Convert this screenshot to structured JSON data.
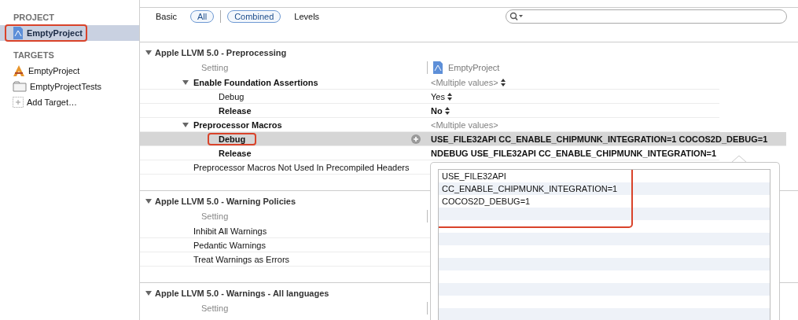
{
  "sidebar": {
    "sections": [
      {
        "title": "PROJECT",
        "items": [
          {
            "kind": "project",
            "label": "EmptyProject",
            "selected": true,
            "highlighted": true
          }
        ]
      },
      {
        "title": "TARGETS",
        "items": [
          {
            "kind": "app",
            "label": "EmptyProject",
            "selected": false,
            "highlighted": false
          },
          {
            "kind": "tests",
            "label": "EmptyProjectTests",
            "selected": false,
            "highlighted": false
          },
          {
            "kind": "add",
            "label": "Add Target…",
            "selected": false,
            "highlighted": false
          }
        ]
      }
    ]
  },
  "filter_groups": [
    [
      {
        "label": "Basic",
        "selected": false
      },
      {
        "label": "All",
        "selected": true
      }
    ],
    [
      {
        "label": "Combined",
        "selected": true
      },
      {
        "label": "Levels",
        "selected": false
      }
    ]
  ],
  "sections": [
    {
      "title": "Apple LLVM 5.0 - Preprocessing",
      "expanded": true,
      "column_header": "Setting",
      "target": "EmptyProject",
      "rows": [
        {
          "label": "Enable Foundation Assertions",
          "value": "<Multiple values>",
          "muted": true,
          "stepper": true,
          "modified": true,
          "selected": false,
          "highlighted": false,
          "expanded": true,
          "children": [
            {
              "label": "Debug",
              "value": "Yes",
              "muted": false,
              "stepper": true,
              "modified": false,
              "selected": false,
              "highlighted": false
            },
            {
              "label": "Release",
              "value": "No",
              "muted": false,
              "stepper": true,
              "modified": true,
              "selected": false,
              "highlighted": false
            }
          ]
        },
        {
          "label": "Preprocessor Macros",
          "value": "<Multiple values>",
          "muted": true,
          "stepper": false,
          "modified": true,
          "selected": false,
          "highlighted": false,
          "expanded": true,
          "children": [
            {
              "label": "Debug",
              "value": "USE_FILE32API CC_ENABLE_CHIPMUNK_INTEGRATION=1 COCOS2D_DEBUG=1",
              "muted": false,
              "stepper": false,
              "modified": true,
              "selected": true,
              "highlighted": true
            },
            {
              "label": "Release",
              "value": "NDEBUG USE_FILE32API CC_ENABLE_CHIPMUNK_INTEGRATION=1",
              "muted": false,
              "stepper": false,
              "modified": true,
              "selected": false,
              "highlighted": false
            }
          ]
        },
        {
          "label": "Preprocessor Macros Not Used In Precompiled Headers",
          "modified": false,
          "selected": false,
          "highlighted": false
        }
      ]
    },
    {
      "title": "Apple LLVM 5.0 - Warning Policies",
      "expanded": true,
      "column_header": "Setting",
      "rows": [
        {
          "label": "Inhibit All Warnings",
          "modified": false,
          "selected": false,
          "highlighted": false
        },
        {
          "label": "Pedantic Warnings",
          "modified": false,
          "selected": false,
          "highlighted": false
        },
        {
          "label": "Treat Warnings as Errors",
          "modified": false,
          "selected": false,
          "highlighted": false
        }
      ]
    },
    {
      "title": "Apple LLVM 5.0 - Warnings - All languages",
      "expanded": true,
      "column_header": "Setting"
    }
  ],
  "popover": {
    "highlighted": true,
    "entries": [
      "USE_FILE32API",
      "CC_ENABLE_CHIPMUNK_INTEGRATION=1",
      "COCOS2D_DEBUG=1"
    ]
  }
}
